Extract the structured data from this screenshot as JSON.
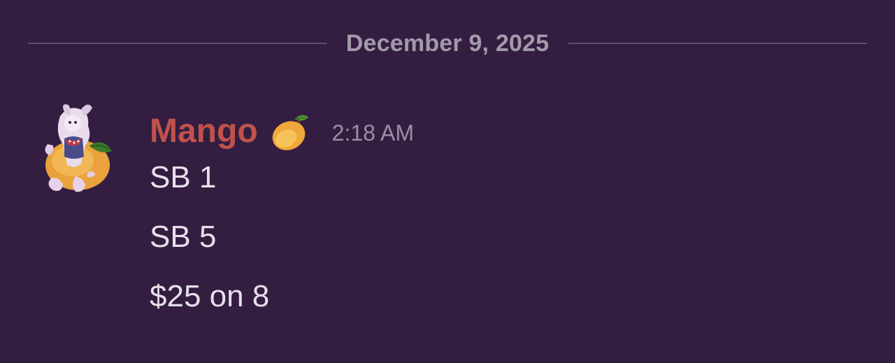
{
  "divider": {
    "date": "December 9, 2025"
  },
  "message": {
    "author": {
      "name": "Mango",
      "name_color": "#c0524c",
      "badge_emoji": "mango-emoji",
      "avatar": "mango-character-avatar"
    },
    "timestamp": "2:18 AM",
    "lines": [
      "SB 1",
      "SB 5",
      "$25 on 8"
    ]
  },
  "colors": {
    "background": "#331d41",
    "divider_line": "#5f4e6b",
    "date_text": "#a39aa9",
    "message_text": "#e6e0ea",
    "timestamp_text": "#9a90a1"
  }
}
